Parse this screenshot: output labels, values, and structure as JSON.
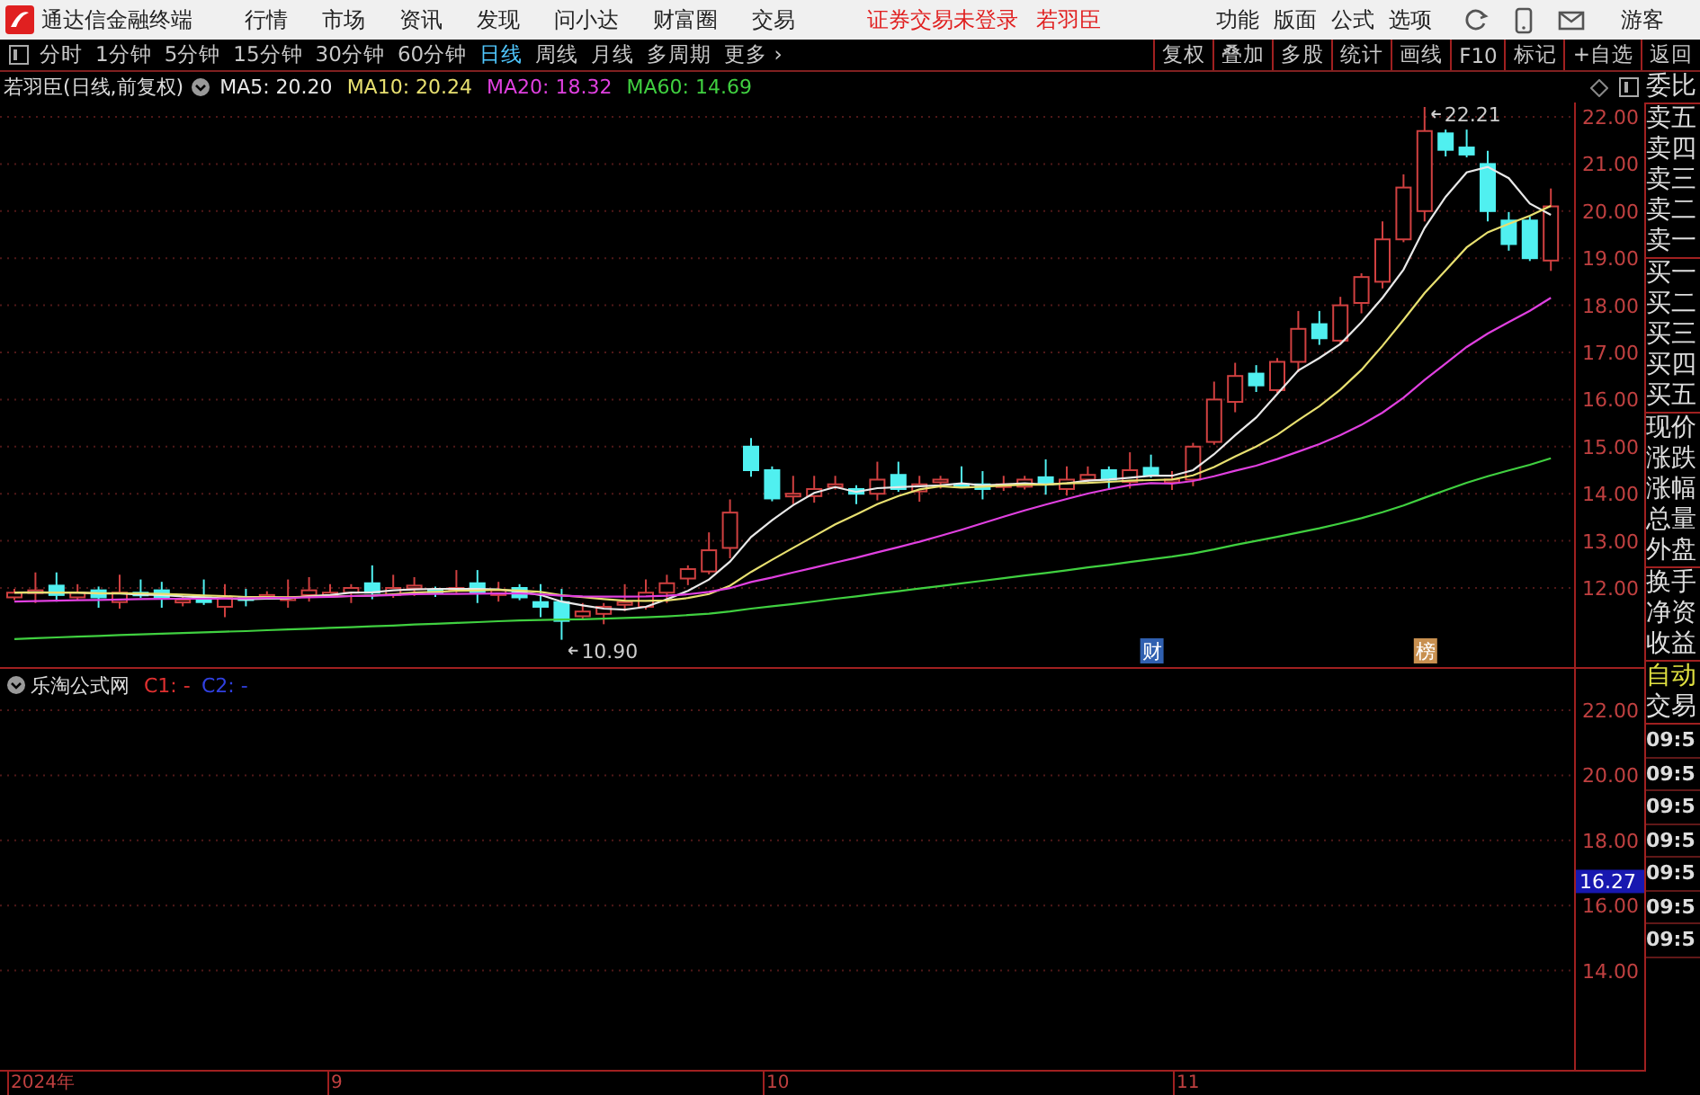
{
  "title_bar": {
    "app_name": "通达信金融终端",
    "menus": [
      "行情",
      "市场",
      "资讯",
      "发现",
      "问小达",
      "财富圈",
      "交易"
    ],
    "login_status": "证券交易未登录",
    "user": "若羽臣",
    "right_menus": [
      "功能",
      "版面",
      "公式",
      "选项"
    ],
    "guest": "游客"
  },
  "toolbar": {
    "periods": [
      {
        "label": "分时",
        "selected": false
      },
      {
        "label": "1分钟",
        "selected": false
      },
      {
        "label": "5分钟",
        "selected": false
      },
      {
        "label": "15分钟",
        "selected": false
      },
      {
        "label": "30分钟",
        "selected": false
      },
      {
        "label": "60分钟",
        "selected": false
      },
      {
        "label": "日线",
        "selected": true
      },
      {
        "label": "周线",
        "selected": false
      },
      {
        "label": "月线",
        "selected": false
      },
      {
        "label": "多周期",
        "selected": false
      }
    ],
    "more": "更多 ›",
    "buttons": [
      "复权",
      "叠加",
      "多股",
      "统计",
      "画线",
      "F10",
      "标记",
      "+自选",
      "返回"
    ]
  },
  "main_chart": {
    "title": "若羽臣(日线,前复权)",
    "moving_averages": [
      {
        "label": "MA5: 20.20",
        "color": "#e8e8e8"
      },
      {
        "label": "MA10: 20.24",
        "color": "#e8e070"
      },
      {
        "label": "MA20: 18.32",
        "color": "#e040e0"
      },
      {
        "label": "MA60: 14.69",
        "color": "#40d040"
      }
    ],
    "price_ticks": [
      "22.00",
      "21.00",
      "20.00",
      "19.00",
      "18.00",
      "17.00",
      "16.00",
      "15.00",
      "14.00",
      "13.00",
      "12.00"
    ],
    "annotations": [
      {
        "label": "22.21",
        "kind": "high"
      },
      {
        "label": "10.90",
        "kind": "low"
      }
    ],
    "markers": [
      {
        "label": "财",
        "color": "#3060b0"
      },
      {
        "label": "榜",
        "color": "#c89050"
      }
    ]
  },
  "sub_chart": {
    "indicator": "乐淘公式网",
    "params": [
      {
        "label": "C1: -",
        "color": "#e03030"
      },
      {
        "label": "C2: -",
        "color": "#3040e0"
      }
    ],
    "ticks": [
      "22.00",
      "20.00",
      "18.00",
      "16.00",
      "14.00"
    ],
    "current_value": "16.27"
  },
  "x_axis": [
    "2024年",
    "9",
    "10",
    "11"
  ],
  "right_panel": {
    "groups": [
      [
        "委比"
      ],
      [
        "卖五",
        "卖四",
        "卖三",
        "卖二",
        "卖一"
      ],
      [
        "买一",
        "买二",
        "买三",
        "买四",
        "买五"
      ],
      [
        "现价",
        "涨跌",
        "涨幅",
        "总量",
        "外盘"
      ],
      [
        "换手",
        "净资",
        "收益"
      ]
    ],
    "auto_label": "自动",
    "trade_label": "交易",
    "times": [
      "09:5",
      "09:5",
      "09:5",
      "09:5",
      "09:5",
      "09:5",
      "09:5"
    ]
  }
}
